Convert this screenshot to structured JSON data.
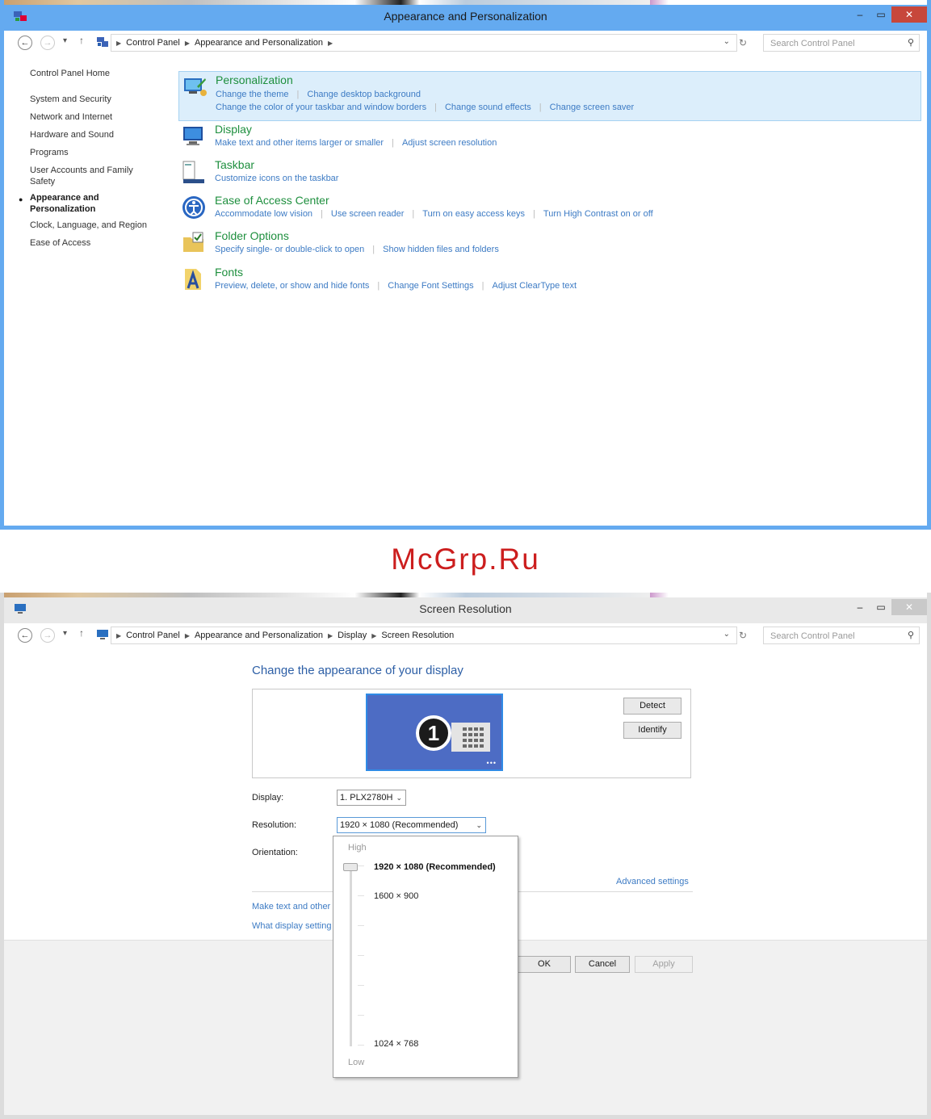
{
  "window1": {
    "title": "Appearance and Personalization",
    "breadcrumb": [
      "Control Panel",
      "Appearance and Personalization"
    ],
    "search_placeholder": "Search Control Panel",
    "left_nav": [
      {
        "label": "Control Panel Home"
      },
      {
        "label": "System and Security"
      },
      {
        "label": "Network and Internet"
      },
      {
        "label": "Hardware and Sound"
      },
      {
        "label": "Programs"
      },
      {
        "label": "User Accounts and Family Safety"
      },
      {
        "label": "Appearance and Personalization",
        "active": true
      },
      {
        "label": "Clock, Language, and Region"
      },
      {
        "label": "Ease of Access"
      }
    ],
    "categories": [
      {
        "title": "Personalization",
        "links": [
          "Change the theme",
          "Change desktop background",
          "Change the color of your taskbar and window borders",
          "Change sound effects",
          "Change screen saver"
        ]
      },
      {
        "title": "Display",
        "links": [
          "Make text and other items larger or smaller",
          "Adjust screen resolution"
        ]
      },
      {
        "title": "Taskbar",
        "links": [
          "Customize icons on the taskbar"
        ]
      },
      {
        "title": "Ease of Access Center",
        "links": [
          "Accommodate low vision",
          "Use screen reader",
          "Turn on easy access keys",
          "Turn High Contrast on or off"
        ]
      },
      {
        "title": "Folder Options",
        "links": [
          "Specify single- or double-click to open",
          "Show hidden files and folders"
        ]
      },
      {
        "title": "Fonts",
        "links": [
          "Preview, delete, or show and hide fonts",
          "Change Font Settings",
          "Adjust ClearType text"
        ]
      }
    ]
  },
  "watermark": "McGrp.Ru",
  "window2": {
    "title": "Screen Resolution",
    "breadcrumb": [
      "Control Panel",
      "Appearance and Personalization",
      "Display",
      "Screen Resolution"
    ],
    "search_placeholder": "Search Control Panel",
    "heading": "Change the appearance of your display",
    "monitor_number": "1",
    "detect_label": "Detect",
    "identify_label": "Identify",
    "display_label": "Display:",
    "display_value": "1. PLX2780H",
    "resolution_label": "Resolution:",
    "resolution_value": "1920 × 1080 (Recommended)",
    "orientation_label": "Orientation:",
    "advanced_link": "Advanced settings",
    "link_text_size": "Make text and other",
    "link_display_settings": "What display setting",
    "ok_label": "OK",
    "cancel_label": "Cancel",
    "apply_label": "Apply",
    "resolution_dropdown": {
      "high_label": "High",
      "low_label": "Low",
      "options": [
        "1920 × 1080 (Recommended)",
        "1600 × 900",
        "1024 × 768"
      ],
      "selected": "1920 × 1080 (Recommended)"
    }
  },
  "colors": {
    "accent_border": "#64aaf0",
    "close_button": "#c7473b",
    "category_title": "#1e8f3e",
    "link": "#3d7bc4",
    "watermark": "#cc1e1e",
    "heading_blue": "#2d5fa6"
  },
  "icons": {
    "back": "back-arrow-icon",
    "forward": "forward-arrow-icon",
    "up": "up-arrow-icon",
    "refresh": "refresh-icon",
    "search": "search-icon",
    "control_panel": "control-panel-icon"
  }
}
